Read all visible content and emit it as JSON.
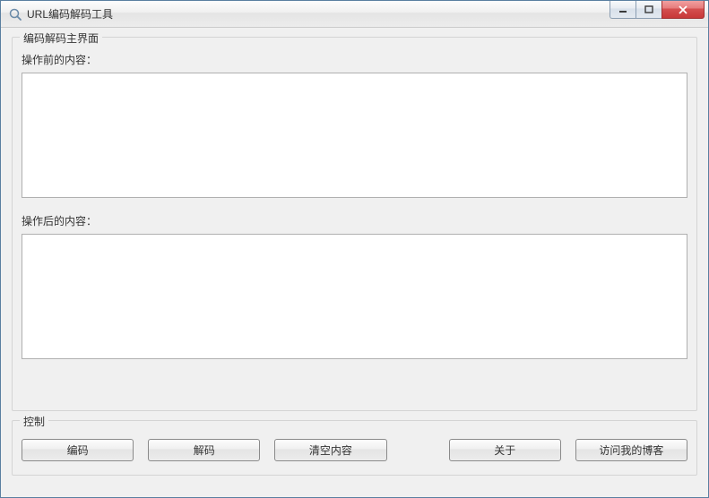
{
  "window": {
    "title": "URL编码解码工具"
  },
  "main_group": {
    "title": "编码解码主界面",
    "before_label": "操作前的内容：",
    "before_value": "",
    "after_label": "操作后的内容：",
    "after_value": ""
  },
  "control_group": {
    "title": "控制",
    "buttons": {
      "encode": "编码",
      "decode": "解码",
      "clear": "清空内容",
      "about": "关于",
      "visit_blog": "访问我的博客"
    }
  }
}
